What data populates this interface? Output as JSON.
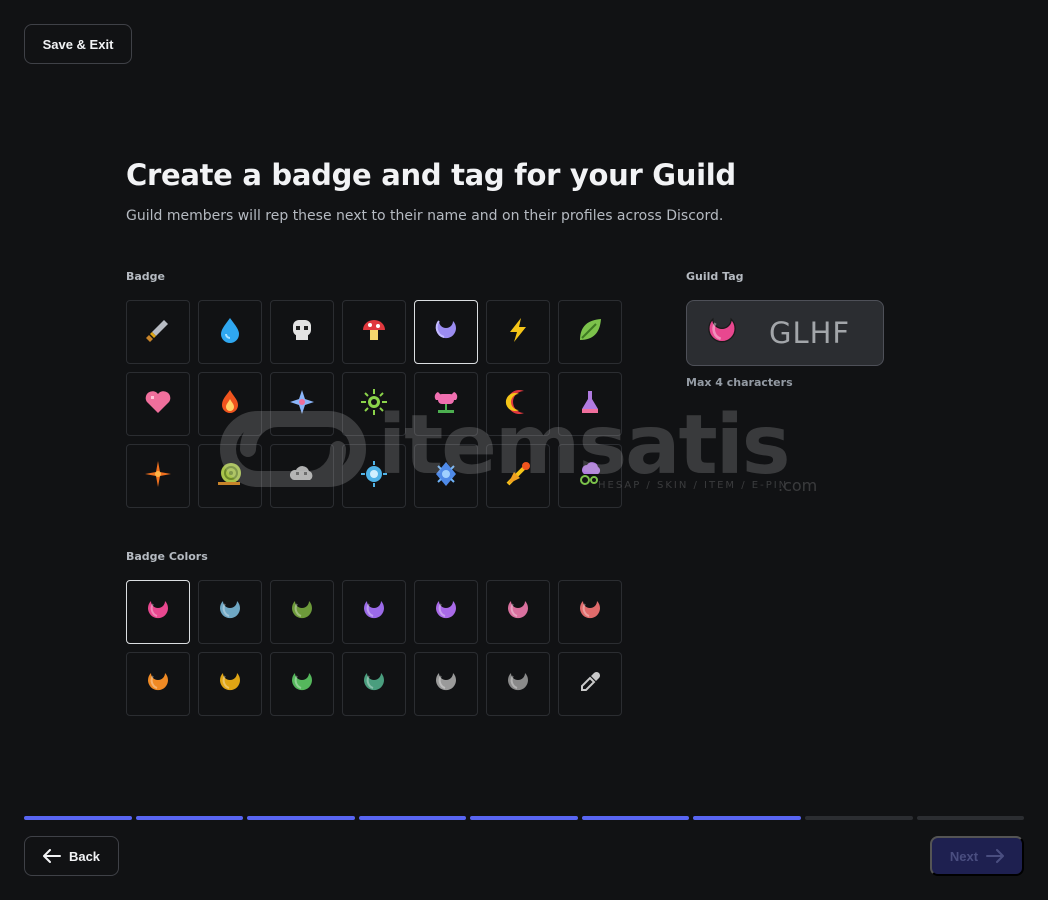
{
  "header": {
    "save_exit_label": "Save & Exit"
  },
  "page": {
    "title": "Create a badge and tag for your Guild",
    "subtitle": "Guild members will rep these next to their name and on their profiles across Discord."
  },
  "badge_section": {
    "label": "Badge",
    "selected_index": 4,
    "badges": [
      "sword-icon",
      "water-drop-icon",
      "skull-icon",
      "mushroom-icon",
      "moon-icon",
      "lightning-icon",
      "leaf-icon",
      "heart-icon",
      "fire-icon",
      "sparkle-icon",
      "sun-icon",
      "flower-icon",
      "crescent-icon",
      "potion-icon",
      "compass-star-icon",
      "snail-icon",
      "cloud-icon",
      "orb-icon",
      "crystal-icon",
      "comet-icon",
      "wind-cloud-icon"
    ]
  },
  "colors_section": {
    "label": "Badge Colors",
    "selected_index": 0,
    "colors": [
      "#e8478f",
      "#6fa7c4",
      "#6d9a3a",
      "#9b6ae8",
      "#a96ae8",
      "#d9709e",
      "#e06b6b",
      "#f08a24",
      "#e0a514",
      "#55b85c",
      "#4a9e7e",
      "#9a9a9a",
      "#8a8a8a",
      "eyedropper"
    ]
  },
  "guild_tag": {
    "label": "Guild Tag",
    "value": "GLHF",
    "hint": "Max 4 characters",
    "badge_color": "#e8478f"
  },
  "watermark": {
    "brand": "itemsatis",
    "tagline": "HESAP / SKIN / ITEM / E-PIN",
    "domain": ".com"
  },
  "progress": {
    "total_steps": 9,
    "completed_steps": 7
  },
  "footer": {
    "back_label": "Back",
    "next_label": "Next"
  },
  "theme": {
    "accent": "#5865f2",
    "background": "#111214"
  }
}
